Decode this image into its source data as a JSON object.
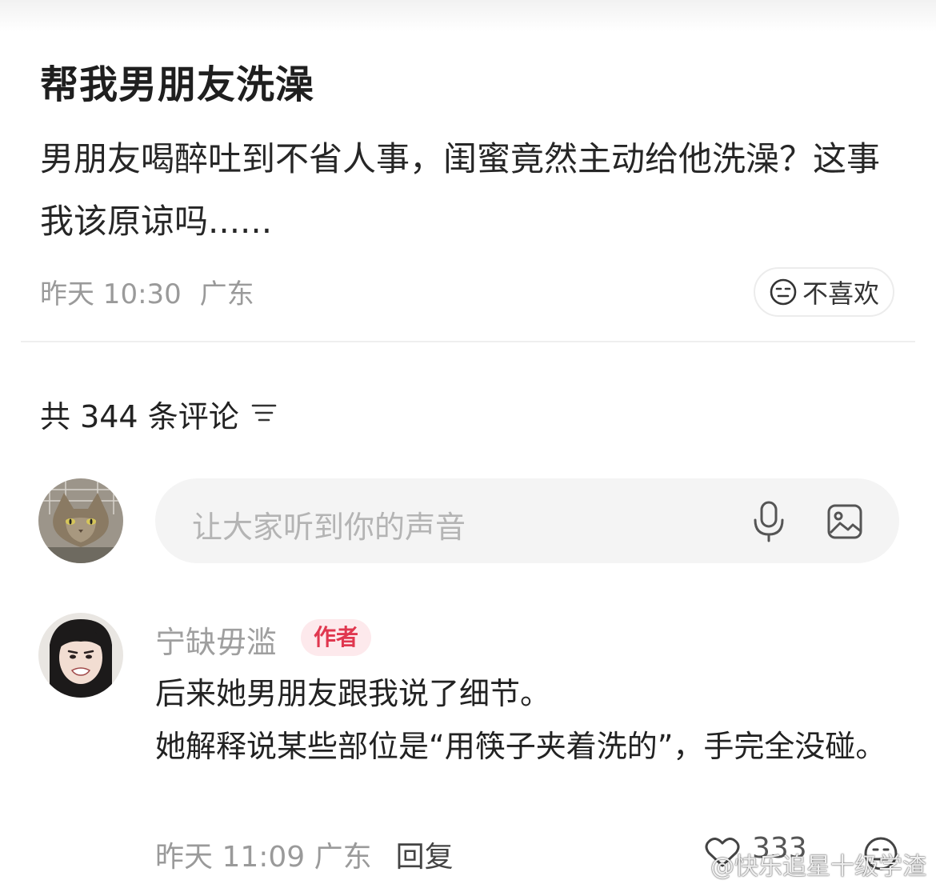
{
  "post": {
    "title": "帮我男朋友洗澡",
    "body": "男朋友喝醉吐到不省人事，闺蜜竟然主动给他洗澡？这事我该原谅吗......",
    "date": "昨天 10:30",
    "location": "广东",
    "dislike_label": "不喜欢"
  },
  "comments_header": {
    "label": "共 344 条评论"
  },
  "input": {
    "placeholder": "让大家听到你的声音"
  },
  "comment": {
    "username": "宁缺毋滥",
    "badge": "作者",
    "line1": "后来她男朋友跟我说了细节。",
    "line2": "她解释说某些部位是“用筷子夹着洗的”，手完全没碰。",
    "date": "昨天 11:09",
    "location": "广东",
    "reply_label": "回复",
    "like_count": "333"
  },
  "watermark": {
    "text": "@快乐追星十级学渣"
  },
  "colors": {
    "accent": "#e0374f",
    "muted": "#9a9a9a",
    "input_bg": "#f4f4f4"
  }
}
